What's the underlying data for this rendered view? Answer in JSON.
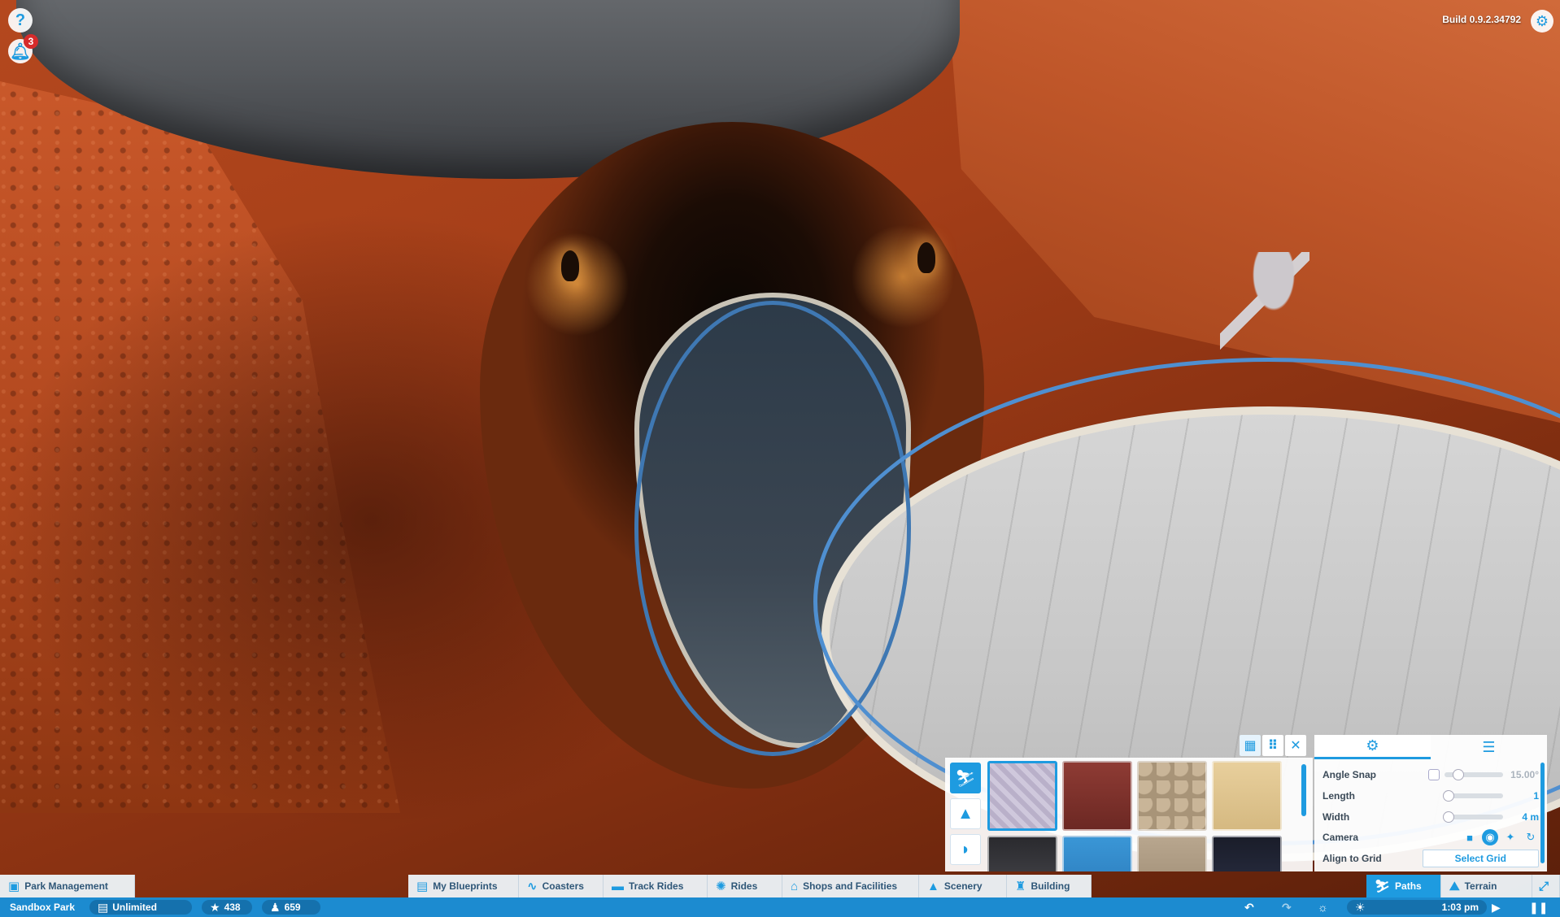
{
  "hud": {
    "notification_count": "3",
    "build_label": "Build 0.9.2.34792"
  },
  "path_panel": {
    "selected_swatch_index": 0,
    "swatch_count": 8,
    "settings": {
      "angle_snap_label": "Angle Snap",
      "angle_snap_value": "15.00°",
      "length_label": "Length",
      "length_value": "1",
      "width_label": "Width",
      "width_value": "4 m",
      "camera_label": "Camera",
      "align_label": "Align to Grid",
      "align_button": "Select Grid"
    }
  },
  "toolbar": {
    "park_management": "Park Management",
    "my_blueprints": "My Blueprints",
    "coasters": "Coasters",
    "track_rides": "Track Rides",
    "rides": "Rides",
    "shops": "Shops and Facilities",
    "scenery": "Scenery",
    "building": "Building",
    "paths": "Paths",
    "terrain": "Terrain"
  },
  "statusbar": {
    "park_name": "Sandbox Park",
    "money": "Unlimited",
    "rating": "438",
    "guests": "659",
    "time": "1:03 pm"
  },
  "colors": {
    "accent": "#1e9be0",
    "statusbar": "#1c8bd0",
    "badge": "#d62b2b"
  }
}
